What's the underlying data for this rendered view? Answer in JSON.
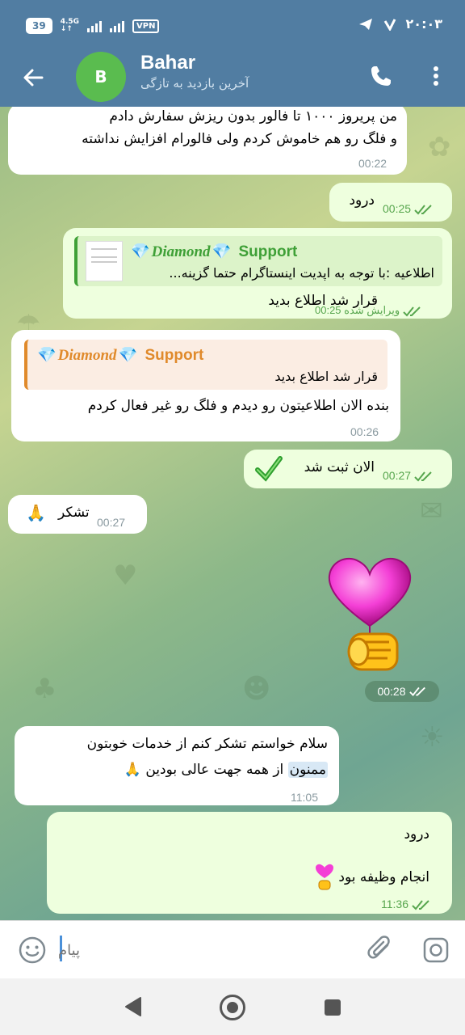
{
  "status_bar": {
    "battery": "39",
    "network": "4.5G",
    "vpn": "VPN",
    "time": "۲۰:۰۳"
  },
  "header": {
    "avatar_letter": "B",
    "name": "Bahar",
    "last_seen": "آخرین بازدید به تازگی"
  },
  "messages": {
    "m1": {
      "text_line1": "من پریروز ۱۰۰۰ تا فالور بدون ریزش سفارش دادم",
      "text_line2": "و فلگ رو هم خاموش کردم ولی فالورام افزایش نداشته",
      "time": "00:22"
    },
    "m2": {
      "text": "درود",
      "time": "00:25"
    },
    "m3": {
      "reply_name": "Diamond",
      "reply_name2": "Support",
      "reply_text": "اطلاعیه :با توجه به اپدیت اینستاگرام حتما گزینه...",
      "text": "قرار شد اطلاع بدید",
      "edited": "ویرایش شده",
      "time": "00:25"
    },
    "m4": {
      "reply_name": "Diamond",
      "reply_name2": "Support",
      "reply_text": "قرار شد اطلاع بدید",
      "text": "بنده الان اطلاعیتون رو دیدم و فلگ رو غیر فعال کردم",
      "time": "00:26"
    },
    "m5": {
      "text": "الان ثبت شد",
      "time": "00:27"
    },
    "m6": {
      "text": "تشکر",
      "time": "00:27"
    },
    "m7": {
      "time": "00:28"
    },
    "m8": {
      "text_line1": "سلام خواستم تشکر کنم از خدمات خوبتون",
      "highlight": "ممنون",
      "text_line2_rest": "از همه جهت عالی بودین",
      "time": "11:05"
    },
    "m9": {
      "text_line1": "درود",
      "text_line2": "انجام وظیفه بود",
      "time": "11:36"
    }
  },
  "input": {
    "placeholder": "پیام"
  },
  "colors": {
    "header": "#517DA2",
    "outgoing": "#EEFFDE",
    "incoming": "#FFFFFF",
    "accent_green": "#57A64E",
    "reply_green": "#3FA037",
    "reply_orange": "#E08A2B"
  }
}
